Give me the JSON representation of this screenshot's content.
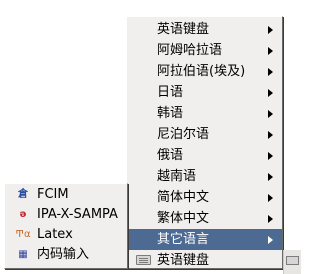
{
  "menu": {
    "items": [
      {
        "label": "英语键盘",
        "has_submenu": true
      },
      {
        "label": "阿姆哈拉语",
        "has_submenu": true
      },
      {
        "label": "阿拉伯语(埃及)",
        "has_submenu": true
      },
      {
        "label": "日语",
        "has_submenu": true
      },
      {
        "label": "韩语",
        "has_submenu": true
      },
      {
        "label": "尼泊尔语",
        "has_submenu": true
      },
      {
        "label": "俄语",
        "has_submenu": true
      },
      {
        "label": "越南语",
        "has_submenu": true
      },
      {
        "label": "简体中文",
        "has_submenu": true
      },
      {
        "label": "繁体中文",
        "has_submenu": true
      },
      {
        "label": "其它语言",
        "has_submenu": true,
        "active": true
      },
      {
        "label": "英语键盘",
        "icon": "keyboard-icon"
      }
    ]
  },
  "submenu": {
    "items": [
      {
        "label": "FCIM",
        "icon": "fcim-icon"
      },
      {
        "label": "IPA-X-SAMPA",
        "icon": "ipa-icon"
      },
      {
        "label": "Latex",
        "icon": "latex-icon"
      },
      {
        "label": "内码输入",
        "icon": "code-input-icon"
      }
    ]
  },
  "colors": {
    "menu_bg": "#f0efed",
    "highlight": "#4d6a93"
  }
}
